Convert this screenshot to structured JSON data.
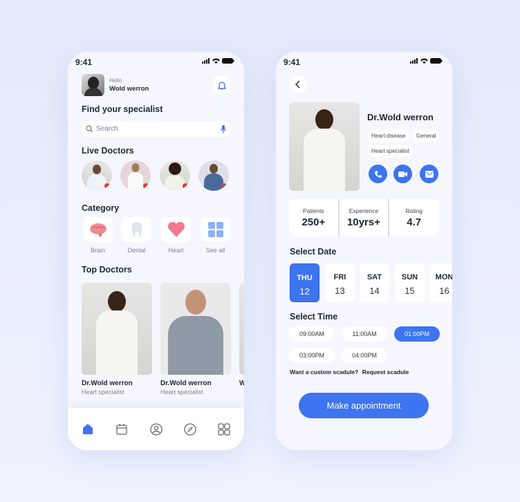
{
  "status": {
    "time": "9:41"
  },
  "home": {
    "greeting": "Hello",
    "user_name": "Wold werron",
    "find_title": "Find your specialist",
    "search": {
      "placeholder": "Search"
    },
    "live_title": "Live Doctors",
    "category_title": "Category",
    "categories": [
      {
        "label": "Brain",
        "icon": "brain-icon"
      },
      {
        "label": "Dental",
        "icon": "tooth-icon"
      },
      {
        "label": "Heart",
        "icon": "heart-icon"
      },
      {
        "label": "See all",
        "icon": "grid-icon"
      }
    ],
    "top_title": "Top Doctors",
    "top_doctors": [
      {
        "name": "Dr.Wold werron",
        "specialty": "Heart specialist"
      },
      {
        "name": "Dr.Wold werron",
        "specialty": "Heart specialist"
      },
      {
        "name": "W",
        "specialty": ""
      }
    ],
    "nav": [
      "home-icon",
      "calendar-icon",
      "profile-icon",
      "compass-icon",
      "grid-icon"
    ]
  },
  "detail": {
    "name": "Dr.Wold werron",
    "tags": [
      "Heart disease",
      "General",
      "Heart specialist"
    ],
    "stats": [
      {
        "label": "Patients",
        "value": "250+"
      },
      {
        "label": "Experience",
        "value": "10yrs+"
      },
      {
        "label": "Rating",
        "value": "4.7"
      }
    ],
    "date_title": "Select Date",
    "dates": [
      {
        "day": "THU",
        "num": "12",
        "selected": true
      },
      {
        "day": "FRI",
        "num": "13"
      },
      {
        "day": "SAT",
        "num": "14"
      },
      {
        "day": "SUN",
        "num": "15"
      },
      {
        "day": "MON",
        "num": "16"
      }
    ],
    "time_title": "Select Time",
    "times": [
      {
        "t": "09:00AM"
      },
      {
        "t": "11:00AM"
      },
      {
        "t": "01:00PM",
        "selected": true
      },
      {
        "t": "03:00PM"
      },
      {
        "t": "04:00PM"
      }
    ],
    "custom_q": "Want a custom scadule?",
    "custom_link": "Request scadule",
    "cta": "Make appointment"
  },
  "colors": {
    "accent": "#3d74f0",
    "live_dot": "#e53935"
  }
}
